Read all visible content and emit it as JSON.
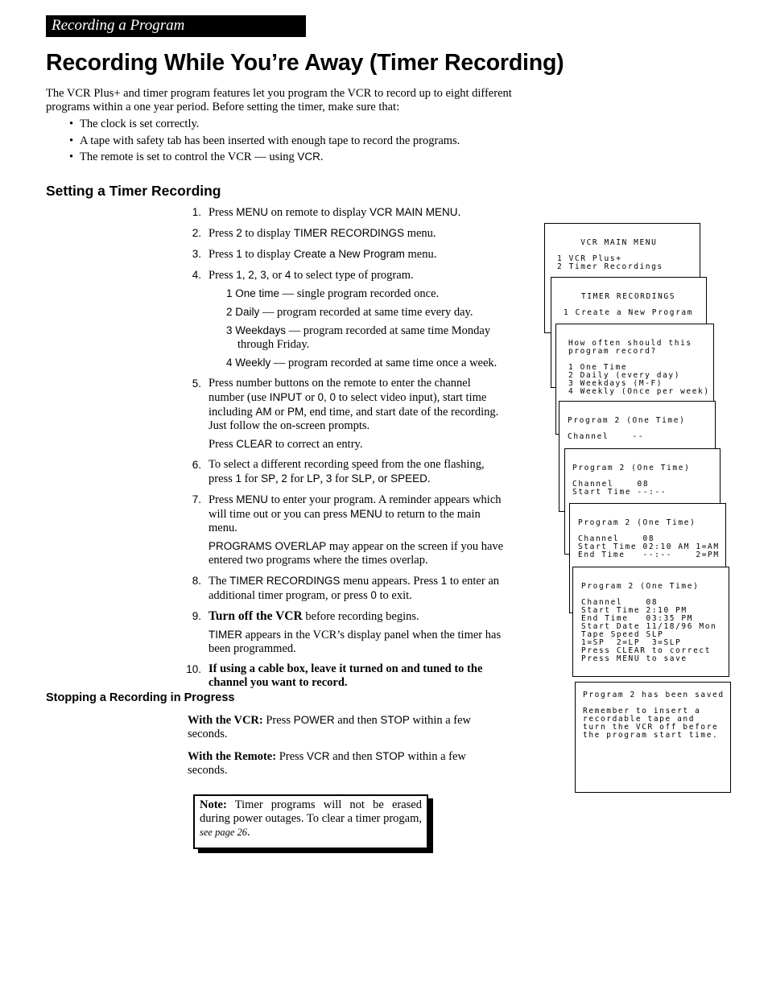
{
  "section_header": "Recording a Program",
  "title": "Recording While You’re Away (Timer Recording)",
  "intro": {
    "text": "The VCR Plus+ and timer program features let you program the VCR to record up to eight different programs within a one year period.  Before setting the timer, make sure that:",
    "bullets": [
      [
        "The clock is set correctly."
      ],
      [
        "A tape with safety tab has been inserted with enough tape to record the programs."
      ],
      [
        "The remote is set to control the VCR — using ",
        "VCR",
        "."
      ]
    ]
  },
  "setting_heading": "Setting a Timer Recording",
  "steps": [
    {
      "num": "1.",
      "text": [
        "Press ",
        "MENU",
        " on remote to display ",
        "VCR MAIN MENU",
        "."
      ]
    },
    {
      "num": "2.",
      "text": [
        "Press ",
        "2",
        " to display ",
        "TIMER RECORDINGS",
        " menu."
      ]
    },
    {
      "num": "3.",
      "text": [
        "Press ",
        "1",
        " to display ",
        "Create a New Program",
        " menu."
      ]
    },
    {
      "num": "4.",
      "text": [
        "Press ",
        "1, 2, 3,",
        " or ",
        "4",
        " to select type of program."
      ],
      "sub": [
        [
          "",
          "1 One time",
          " — single program recorded once."
        ],
        [
          "",
          "2 Daily",
          " — program recorded at same time every day."
        ],
        [
          "",
          "3 Weekdays",
          " — program recorded at same time Monday through Friday."
        ],
        [
          "",
          "4 Weekly",
          " — program recorded at same time once a week."
        ]
      ]
    },
    {
      "num": "5.",
      "text": [
        "Press number buttons on the remote to enter the channel number (use ",
        "INPUT",
        " or ",
        "0, 0",
        " to select video input), start time including ",
        "AM",
        " or ",
        "PM",
        ", end time, and start date of the recording.  Just follow the on-screen prompts."
      ],
      "extra": [
        "Press ",
        "CLEAR",
        " to correct an entry."
      ]
    },
    {
      "num": "6.",
      "text": [
        "To select a different recording speed from the one flashing, press ",
        "1",
        " for ",
        "SP",
        ", ",
        "2",
        " for ",
        "LP",
        ", ",
        "3",
        " for ",
        "SLP",
        ", ",
        "or SPEED",
        "."
      ]
    },
    {
      "num": "7.",
      "text": [
        "Press ",
        "MENU",
        " to enter your program.  A reminder appears which will time out or you can press ",
        "MENU",
        " to return to the main menu."
      ],
      "extra": [
        "",
        "PROGRAMS OVERLAP",
        " may appear on the screen if you have entered two programs where the times overlap."
      ]
    },
    {
      "num": "8.",
      "text": [
        "The ",
        "TIMER RECORDINGS",
        " menu appears.  Press ",
        "1",
        " to enter an additional timer program, or press ",
        "0",
        " to exit."
      ]
    },
    {
      "num": "9.",
      "text": [
        "Turn off the VCR before recording begins."
      ],
      "bold_lead": "Turn off the VCR",
      "extra": [
        "",
        "TIMER",
        " appears in the VCR’s display panel when the timer has been programmed."
      ]
    },
    {
      "num": "10.",
      "text": [
        "If using a cable box, leave it turned on and tuned to the channel you want to record."
      ],
      "bold": true
    }
  ],
  "stopping_heading": "Stopping a Recording in Progress",
  "stopping": [
    {
      "lead": "With the VCR:",
      "text": [
        "  Press ",
        "POWER",
        " and then ",
        "STOP",
        " within a few seconds."
      ]
    },
    {
      "lead": "With the Remote:",
      "text": [
        "  Press ",
        "VCR",
        " and then ",
        "STOP",
        " within a few seconds."
      ]
    }
  ],
  "note": {
    "lead": "Note:",
    "text": "  Timer programs will not be erased during power outages.  To clear a timer progam, ",
    "ref": "see page 26",
    "end": "."
  },
  "screens": [
    "    VCR MAIN MENU\n\n1 VCR Plus+\n2 Timer Recordings",
    "   TIMER RECORDINGS\n\n1 Create a New Program",
    "How often should this\nprogram record?\n\n1 One Time\n2 Daily (every day)\n3 Weekdays (M-F)\n4 Weekly (Once per week)",
    "Program 2 (One Time)\n\nChannel    --",
    "Program 2 (One Time)\n\nChannel    08\nStart Time --:--",
    "Program 2 (One Time)\n\nChannel    08\nStart Time 02:10 AM 1=AM\nEnd Time   --:--    2=PM",
    "Program 2 (One Time)\n\nChannel    08\nStart Time 2:10 PM\nEnd Time   03:35 PM\nStart Date 11/18/96 Mon\nTape Speed SLP\n1=SP  2=LP  3=SLP\nPress CLEAR to correct\nPress MENU to save",
    "Program 2 has been saved\n\nRemember to insert a\nrecordable tape and\nturn the VCR off before\nthe program start time."
  ]
}
